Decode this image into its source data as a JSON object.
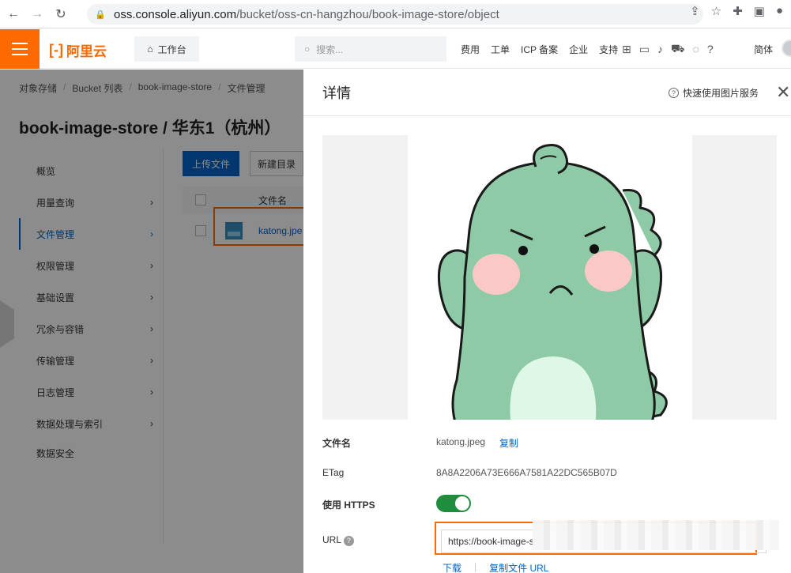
{
  "browser": {
    "url_host": "oss.console.aliyun.com",
    "url_path": "/bucket/oss-cn-hangzhou/book-image-store/object"
  },
  "header": {
    "logo_text": "阿里云",
    "workbench": "工作台",
    "search_placeholder": "搜索...",
    "links": [
      "费用",
      "工单",
      "ICP 备案",
      "企业",
      "支持"
    ],
    "language": "简体"
  },
  "breadcrumb": [
    "对象存储",
    "Bucket 列表",
    "book-image-store",
    "文件管理"
  ],
  "page_title": "book-image-store / 华东1（杭州）",
  "sidebar": {
    "items": [
      {
        "label": "概览",
        "has_arrow": false,
        "active": false
      },
      {
        "label": "用量查询",
        "has_arrow": true,
        "active": false
      },
      {
        "label": "文件管理",
        "has_arrow": true,
        "active": true
      },
      {
        "label": "权限管理",
        "has_arrow": true,
        "active": false
      },
      {
        "label": "基础设置",
        "has_arrow": true,
        "active": false
      },
      {
        "label": "冗余与容错",
        "has_arrow": true,
        "active": false
      },
      {
        "label": "传输管理",
        "has_arrow": true,
        "active": false
      },
      {
        "label": "日志管理",
        "has_arrow": true,
        "active": false
      },
      {
        "label": "数据处理与索引",
        "has_arrow": true,
        "active": false
      },
      {
        "label": "数据安全",
        "has_arrow": false,
        "active": false
      }
    ]
  },
  "toolbar": {
    "upload": "上传文件",
    "new_dir": "新建目录"
  },
  "table": {
    "col_name": "文件名",
    "row_file": "katong.jpe"
  },
  "drawer": {
    "title": "详情",
    "quick_link": "快速使用图片服务",
    "fields": {
      "filename_label": "文件名",
      "filename_value": "katong.jpeg",
      "copy": "复制",
      "etag_label": "ETag",
      "etag_value": "8A8A2206A73E666A7581A22DC565B07D",
      "https_label": "使用 HTTPS",
      "https_enabled": true,
      "url_label": "URL",
      "url_value": "https://book-image-s"
    },
    "actions": {
      "download": "下载",
      "copy_url": "复制文件 URL"
    }
  },
  "colors": {
    "brand": "#ff6a00",
    "primary": "#0064c8",
    "toggle_on": "#1e8e3e"
  }
}
